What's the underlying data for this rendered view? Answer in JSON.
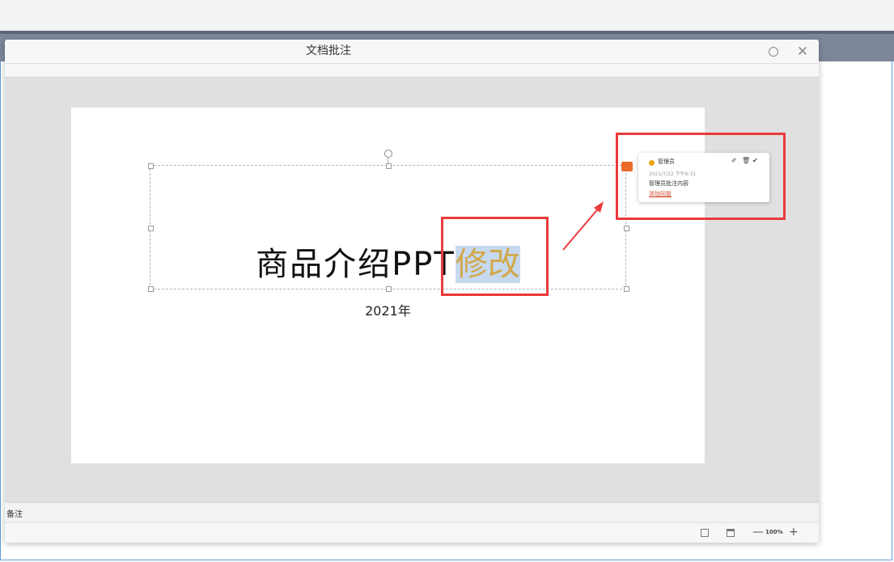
{
  "dialog": {
    "title": "文档批注",
    "restore_label": "",
    "close_label": "✕"
  },
  "slide": {
    "title_plain": "商品介绍PPT",
    "title_edited": "修改",
    "subtitle": "2021年"
  },
  "comment": {
    "author": "管理员",
    "time": "2021/7/22 下午6:31",
    "content": "管理员批注内容",
    "reply_link": "添加回复",
    "edit_icon": "✐",
    "delete_icon": "🗑",
    "resolve_icon": "✔",
    "dot_color": "#e6a60e"
  },
  "notes": {
    "label": "备注"
  },
  "status": {
    "zoom_out": "—",
    "zoom_level": "100%",
    "zoom_in": "+"
  },
  "colors": {
    "annotation_red": "#ea3a3a",
    "highlight_text": "#d2a84a",
    "highlight_bg": "#c7d9ef"
  }
}
